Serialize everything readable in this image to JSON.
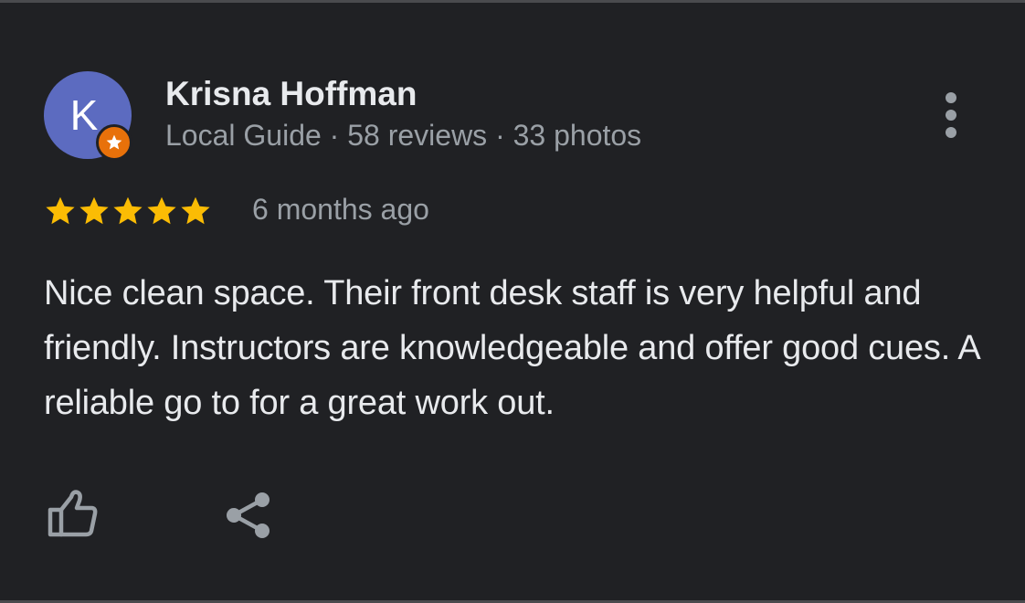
{
  "reviewer": {
    "initial": "K",
    "name": "Krisna Hoffman",
    "meta": "Local Guide · 58 reviews · 33 photos",
    "avatar_color": "#5c6bc0",
    "badge_color": "#e8710a"
  },
  "review": {
    "rating": 5,
    "max_rating": 5,
    "date": "6 months ago",
    "text": "Nice clean space. Their front desk staff is very helpful and friendly. Instructors are knowledgeable and offer good cues. A reliable go to for a great work out."
  },
  "actions": {
    "more_icon": "more-vert-icon",
    "like_icon": "thumbs-up-icon",
    "share_icon": "share-icon"
  },
  "colors": {
    "background": "#202124",
    "star": "#fbbc04",
    "primary_text": "#e8eaed",
    "secondary_text": "#9aa0a6"
  }
}
